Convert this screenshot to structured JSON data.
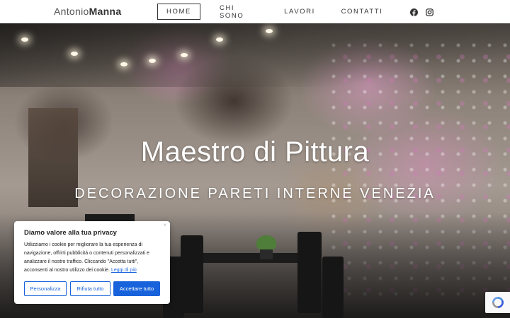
{
  "header": {
    "logo_light": "Antonio",
    "logo_bold": "Manna",
    "nav": [
      "HOME",
      "CHI SONO",
      "LAVORI",
      "CONTATTI"
    ],
    "active_nav": "HOME",
    "social_icons": [
      "facebook-icon",
      "instagram-icon"
    ]
  },
  "hero": {
    "title": "Maestro di Pittura",
    "subtitle": "DECORAZIONE PARETI INTERNE VENEZIA"
  },
  "cookie": {
    "title": "Diamo valore alla tua privacy",
    "text": "Utilizziamo i cookie per migliorare la tua esperienza di navigazione, offrirti pubblicità o contenuti personalizzati e analizzare il nostro traffico. Cliccando \"Accetta tutti\", acconsenti al nostro utilizzo dei cookie.",
    "link": "Leggi di più",
    "close": "×",
    "buttons": {
      "customize": "Personalizza",
      "reject": "Rifiuta tutto",
      "accept": "Accettare tutto"
    },
    "accent_color": "#1863dc"
  }
}
